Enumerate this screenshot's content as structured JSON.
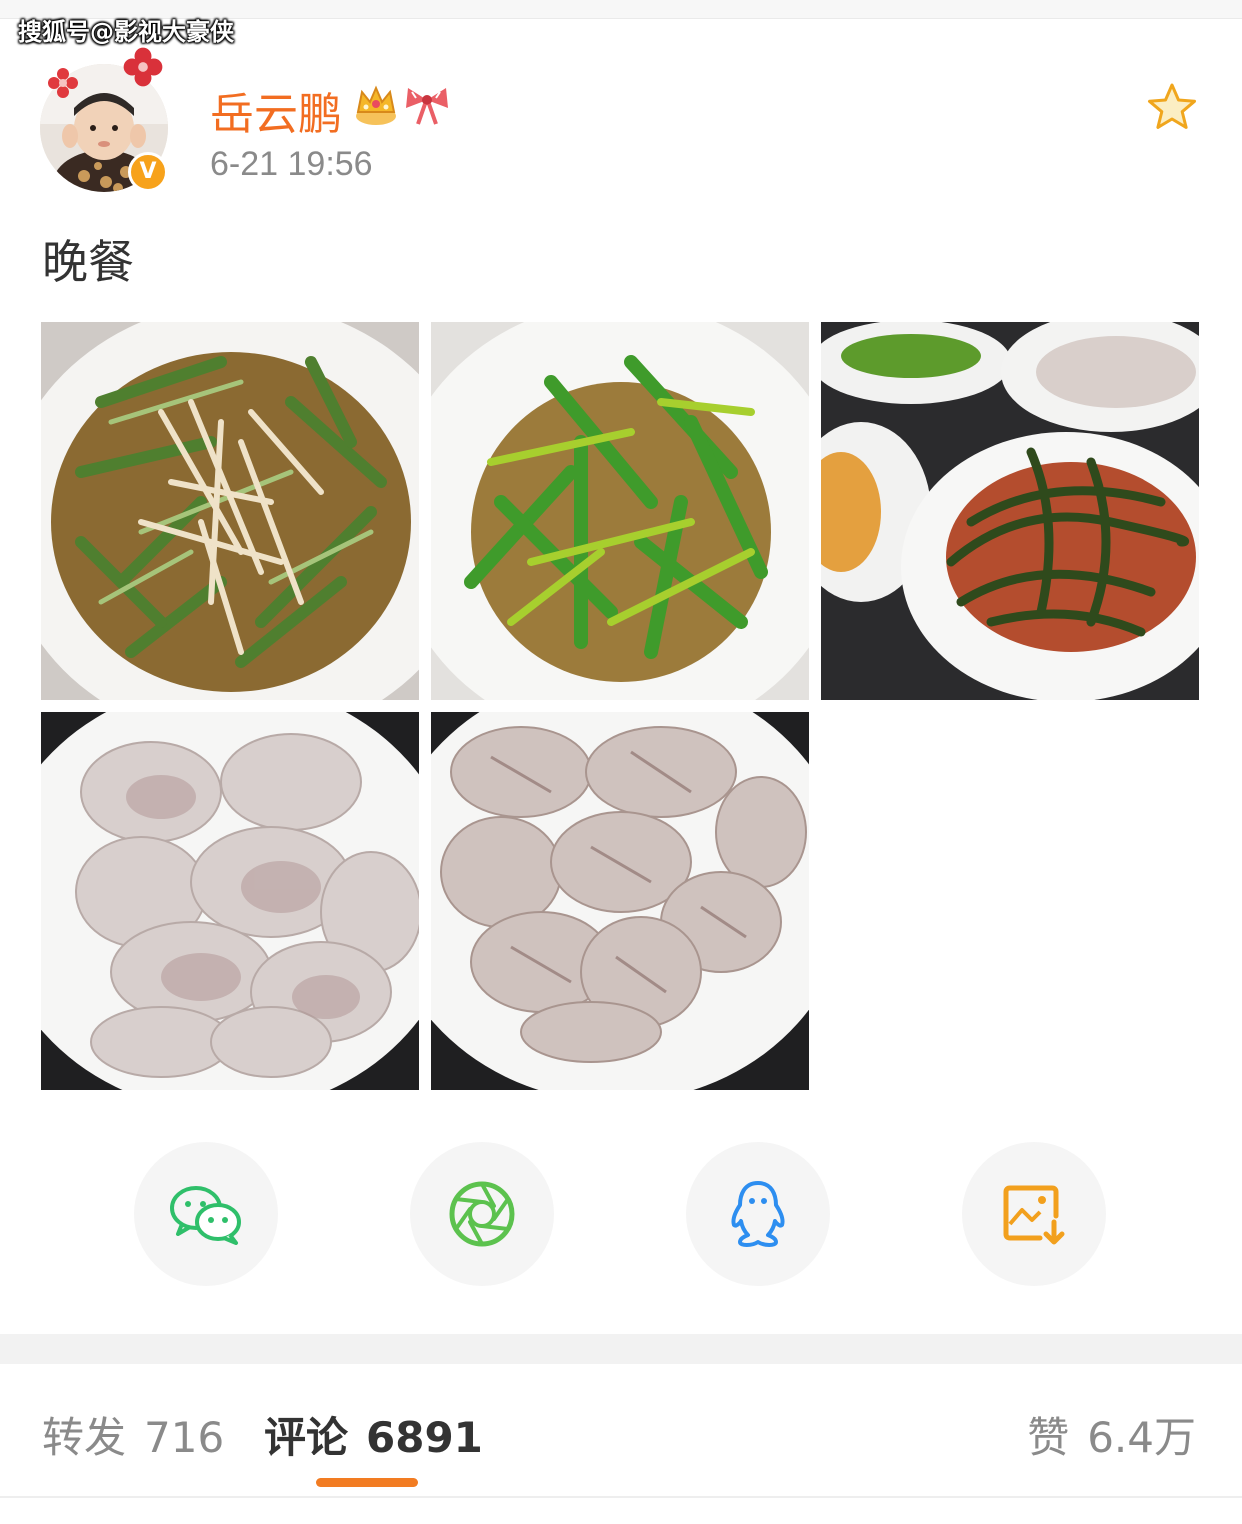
{
  "watermark": "搜狐号@影视大豪侠",
  "post": {
    "username": "岳云鹏",
    "timestamp": "6-21 19:56",
    "text": "晚餐",
    "avatar_icon": "child-avatar",
    "verified_badge": "V",
    "user_badges": [
      "crown-icon",
      "bow-icon"
    ],
    "favorite_icon": "star-icon"
  },
  "photos": [
    {
      "name": "cucumber-enoki-salad"
    },
    {
      "name": "stir-fried-daylily"
    },
    {
      "name": "kelp-and-dumplings-table"
    },
    {
      "name": "dumplings-plate-1"
    },
    {
      "name": "dumplings-plate-2"
    }
  ],
  "share": [
    {
      "name": "wechat-icon",
      "color": "#2fbf6a"
    },
    {
      "name": "moments-icon",
      "color": "#5cc24e"
    },
    {
      "name": "qq-icon",
      "color": "#2d8ef0"
    },
    {
      "name": "save-image-icon",
      "color": "#f2a01d"
    }
  ],
  "tabs": {
    "forward_label": "转发",
    "forward_count": "716",
    "comment_label": "评论",
    "comment_count": "6891",
    "like_label": "赞",
    "like_count": "6.4万"
  },
  "colors": {
    "accent": "#f27c22",
    "username": "#f26d21",
    "muted": "#8a8a8a"
  }
}
